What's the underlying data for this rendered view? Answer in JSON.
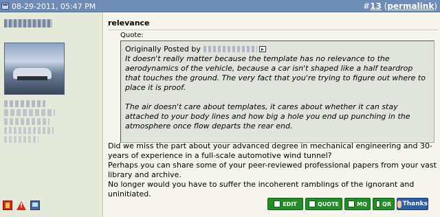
{
  "header": {
    "date": "08-29-2011, 05:47 PM",
    "post_prefix": "#",
    "post_number": "13",
    "permalink_open": " (",
    "permalink_label": "permalink",
    "permalink_close": ")"
  },
  "post": {
    "title": "relevance",
    "quote_label": "Quote:",
    "quote_by": "Originally Posted by",
    "quote_paragraphs": [
      "It doesn't really matter because the template has no relevance to the aerodynamics of the vehicle, because a car isn't shaped like a half teardrop that touches the ground. The very fact that you're trying to figure out where to place it is proof.",
      "The air doesn't care about templates, it cares about whether it can stay attached to your body lines and how big a hole you end up punching in the atmosphere once flow departs the rear end."
    ],
    "body_lines": [
      "Did we miss the part about your advanced degree in mechanical engineering and 30-years of experience in a full-scale automotive wind tunnel?",
      "Perhaps you can share some of your peer-reviewed professional papers from your vast library and archive.",
      "No longer would you have to suffer the incoherent ramblings of the ignorant and uninitiated."
    ]
  },
  "buttons": {
    "edit": "EDIT",
    "quote": "QUOTE",
    "mq": "MQ",
    "qr": "QR",
    "thanks": "Thanks"
  },
  "icons": {
    "post_icon": "post-icon",
    "report": "report-icon",
    "warn": "warning-icon",
    "ip": "computer-icon"
  },
  "colors": {
    "header_bg": "#6d8cb6",
    "user_col_bg": "#e5e9d9",
    "content_bg": "#f5f5ee",
    "quote_bg": "#e1e4dc",
    "button_green": "#1f8f26",
    "thanks_blue": "#2b5ea6"
  }
}
